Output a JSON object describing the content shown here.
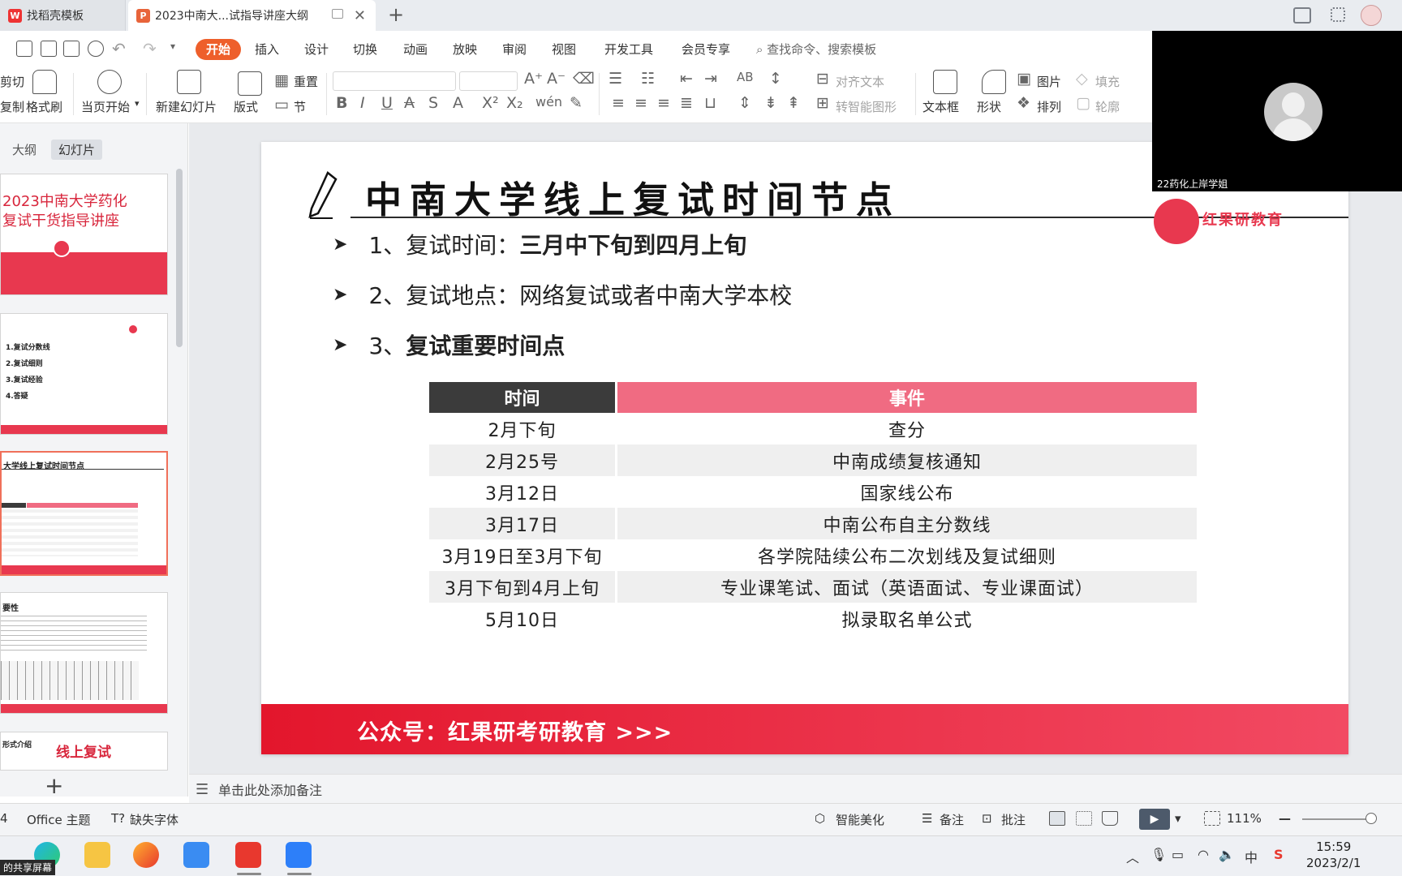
{
  "tabs": [
    {
      "label": "找稻壳模板"
    },
    {
      "label": "2023中南大...试指导讲座大纲"
    }
  ],
  "menu": {
    "items": [
      "开始",
      "插入",
      "设计",
      "切换",
      "动画",
      "放映",
      "审阅",
      "视图",
      "开发工具",
      "会员专享"
    ],
    "search_placeholder": "查找命令、搜索模板"
  },
  "ribbon": {
    "cut": "剪切",
    "copy": "复制",
    "format_painter": "格式刷",
    "from_current": "当页开始",
    "new_slide": "新建幻灯片",
    "layout": "版式",
    "reset": "重置",
    "section": "节",
    "align_text": "对齐文本",
    "smart_shape": "转智能图形",
    "textbox": "文本框",
    "shape": "形状",
    "picture": "图片",
    "arrange": "排列",
    "fill": "填充",
    "outline": "轮廓"
  },
  "panel": {
    "tab_outline": "大纲",
    "tab_slides": "幻灯片",
    "thumb1_line1": "2023中南大学药化",
    "thumb1_line2": "复试干货指导讲座",
    "thumb2_items": [
      "1.复试分数线",
      "2.复试细则",
      "3.复试经验",
      "4.答疑"
    ],
    "thumb3_title": "大学线上复试时间节点",
    "thumb4_title": "要性",
    "thumb5_title": "线上复试",
    "thumb5_side": "形式介绍"
  },
  "video": {
    "name": "22药化上岸学姐"
  },
  "slide": {
    "title": "中南大学线上复试时间节点",
    "bullet1_prefix": "1、复试时间：",
    "bullet1_bold": "三月中下旬到四月上旬",
    "bullet2": "2、复试地点：网络复试或者中南大学本校",
    "bullet3_prefix": "3、",
    "bullet3_bold": "复试重要时间点",
    "logo_text": "红果研教育",
    "footer": "公众号：红果研考研教育 >>>",
    "table": {
      "headers": [
        "时间",
        "事件"
      ],
      "rows": [
        [
          "2月下旬",
          "查分"
        ],
        [
          "2月25号",
          "中南成绩复核通知"
        ],
        [
          "3月12日",
          "国家线公布"
        ],
        [
          "3月17日",
          "中南公布自主分数线"
        ],
        [
          "3月19日至3月下旬",
          "各学院陆续公布二次划线及复试细则"
        ],
        [
          "3月下旬到4月上旬",
          "专业课笔试、面试（英语面试、专业课面试）"
        ],
        [
          "5月10日",
          "拟录取名单公式"
        ]
      ]
    }
  },
  "notes": {
    "placeholder": "单击此处添加备注"
  },
  "status": {
    "slide_num": "4",
    "theme": "Office 主题",
    "missing_font": "缺失字体",
    "smart_beautify": "智能美化",
    "notes": "备注",
    "comment": "批注",
    "zoom": "111%"
  },
  "taskbar": {
    "time": "15:59",
    "date": "2023/2/1",
    "share": "的共享屏幕"
  },
  "colors": {
    "accent": "#ee5f2b",
    "brand_red": "#e8384f",
    "table_header_dark": "#3b3b3b",
    "table_header_pink": "#f06b82"
  }
}
